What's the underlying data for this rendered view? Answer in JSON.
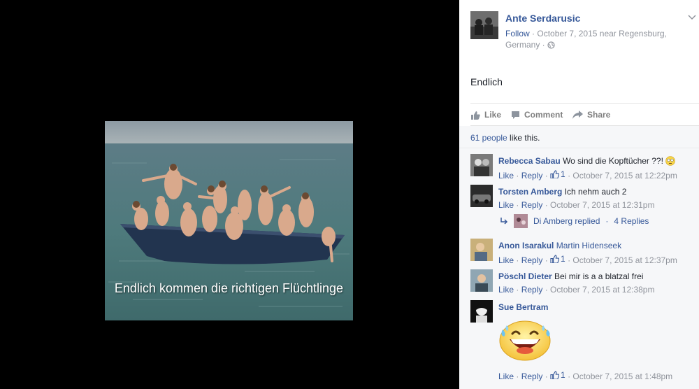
{
  "photo": {
    "caption": "Endlich kommen die richtigen Flüchtlinge"
  },
  "post": {
    "author": "Ante Serdarusic",
    "follow_label": "Follow",
    "meta_line1": "October 7, 2015 near Regensburg,",
    "meta_line2": "Germany ·",
    "globe_icon": "globe-icon",
    "text": "Endlich"
  },
  "actions": {
    "like": "Like",
    "comment": "Comment",
    "share": "Share"
  },
  "likes_summary": {
    "count": "61 people",
    "suffix": " like this."
  },
  "comments": [
    {
      "name": "Rebecca Sabau",
      "text": "Wo sind die Kopftücher ??!",
      "emoji": "flushed-face-icon",
      "like": "Like",
      "reply": "Reply",
      "likes": "1",
      "time": "October 7, 2015 at 12:22pm"
    },
    {
      "name": "Torsten Amberg",
      "text": "Ich nehm auch 2",
      "like": "Like",
      "reply": "Reply",
      "time": "October 7, 2015 at 12:31pm",
      "replies": {
        "who": "Di Amberg replied",
        "sep": " · ",
        "count": "4 Replies"
      }
    },
    {
      "name": "Anon Isarakul",
      "tag": "Martin Hidenseek",
      "like": "Like",
      "reply": "Reply",
      "likes": "1",
      "time": "October 7, 2015 at 12:37pm"
    },
    {
      "name": "Pöschl Dieter",
      "text": "Bei mir is a a blatzal frei",
      "like": "Like",
      "reply": "Reply",
      "time": "October 7, 2015 at 12:38pm"
    },
    {
      "name": "Sue Bertram",
      "sticker": "laughing-tears-face-icon",
      "like": "Like",
      "reply": "Reply",
      "likes": "1",
      "time": "October 7, 2015 at 1:48pm"
    }
  ],
  "colors": {
    "link": "#365899",
    "meta": "#90949c",
    "panel_bg": "#f6f7f9",
    "stage_bg": "#000000"
  }
}
